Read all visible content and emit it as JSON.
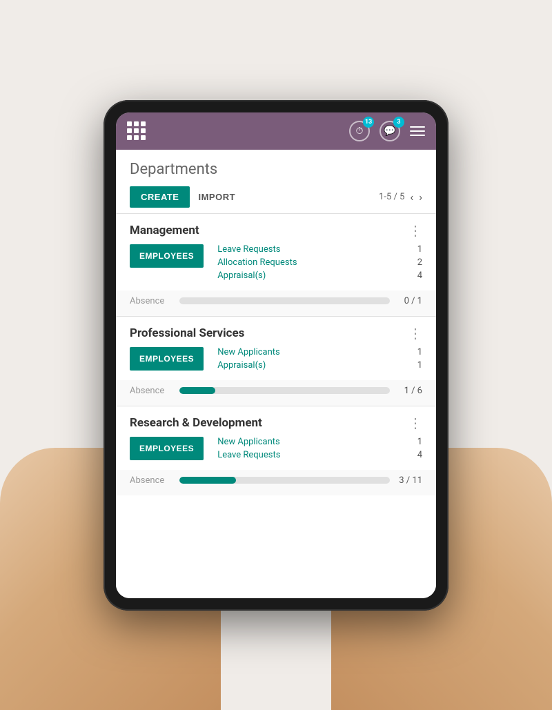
{
  "page": {
    "background_color": "#f0ece8"
  },
  "navbar": {
    "grid_icon_label": "apps",
    "timer_badge": "13",
    "chat_badge": "3",
    "hamburger_label": "menu"
  },
  "header": {
    "title": "Departments",
    "create_label": "CREATE",
    "import_label": "IMPORT",
    "pagination_text": "1-5 / 5",
    "prev_arrow": "‹",
    "next_arrow": "›"
  },
  "departments": [
    {
      "name": "Management",
      "employees_label": "EMPLOYEES",
      "stats": [
        {
          "label": "Leave Requests",
          "value": "1"
        },
        {
          "label": "Allocation Requests",
          "value": "2"
        },
        {
          "label": "Appraisal(s)",
          "value": "4"
        }
      ],
      "absence_label": "Absence",
      "absence_fill_pct": 0,
      "absence_count": "0 / 1"
    },
    {
      "name": "Professional Services",
      "employees_label": "EMPLOYEES",
      "stats": [
        {
          "label": "New Applicants",
          "value": "1"
        },
        {
          "label": "Appraisal(s)",
          "value": "1"
        }
      ],
      "absence_label": "Absence",
      "absence_fill_pct": 17,
      "absence_count": "1 / 6"
    },
    {
      "name": "Research & Development",
      "employees_label": "EMPLOYEES",
      "stats": [
        {
          "label": "New Applicants",
          "value": "1"
        },
        {
          "label": "Leave Requests",
          "value": "4"
        }
      ],
      "absence_label": "Absence",
      "absence_fill_pct": 27,
      "absence_count": "3 / 11"
    }
  ]
}
